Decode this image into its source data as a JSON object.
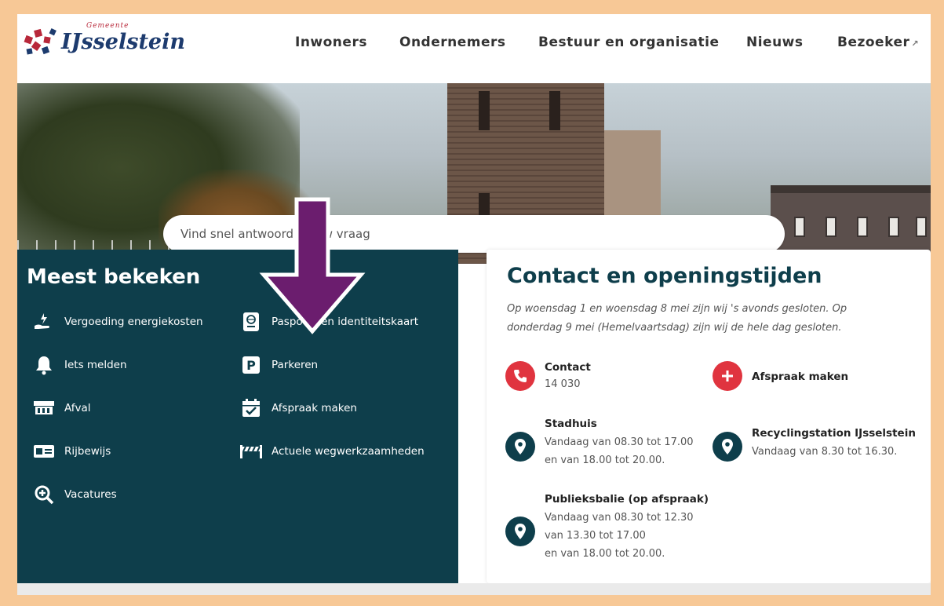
{
  "logo": {
    "small_text": "Gemeente",
    "name": "IJsselstein",
    "colors": {
      "red": "#b8283a",
      "navy": "#1d3b6e"
    }
  },
  "nav": {
    "items": [
      {
        "label": "Inwoners"
      },
      {
        "label": "Ondernemers"
      },
      {
        "label": "Bestuur en organisatie"
      },
      {
        "label": "Nieuws"
      },
      {
        "label": "Bezoeker",
        "icon": "external-link-icon"
      }
    ]
  },
  "search": {
    "placeholder": "Vind snel antwoord op uw vraag"
  },
  "meest_bekeken": {
    "title": "Meest bekeken",
    "left_items": [
      {
        "label": "Vergoeding energiekosten",
        "icon": "energy-hand-icon"
      },
      {
        "label": "Iets melden",
        "icon": "bell-icon"
      },
      {
        "label": "Afval",
        "icon": "waste-container-icon"
      },
      {
        "label": "Rijbewijs",
        "icon": "drivers-license-icon"
      },
      {
        "label": "Vacatures",
        "icon": "search-plus-icon"
      }
    ],
    "right_items": [
      {
        "label": "Paspoort en identiteitskaart",
        "icon": "passport-icon"
      },
      {
        "label": "Parkeren",
        "icon": "parking-icon"
      },
      {
        "label": "Afspraak maken",
        "icon": "calendar-check-icon"
      },
      {
        "label": "Actuele wegwerkzaamheden",
        "icon": "roadworks-icon"
      }
    ]
  },
  "contact": {
    "title": "Contact en openingstijden",
    "note": "Op woensdag 1 en woensdag 8 mei zijn wij 's avonds gesloten. Op donderdag 9 mei (Hemelvaartsdag) zijn wij de hele dag gesloten.",
    "contact_item": {
      "label": "Contact",
      "value": "14 030",
      "icon": "phone-icon"
    },
    "afspraak_item": {
      "label": "Afspraak maken",
      "icon": "plus-icon"
    },
    "stadhuis": {
      "label": "Stadhuis",
      "line1": "Vandaag van 08.30 tot 17.00",
      "line2": "en van 18.00 tot 20.00.",
      "icon": "location-pin-icon"
    },
    "recycling": {
      "label": "Recyclingstation IJsselstein",
      "line1": "Vandaag van 8.30 tot 16.30.",
      "icon": "location-pin-icon"
    },
    "publieksbalie": {
      "label": "Publieksbalie (op afspraak)",
      "line1": "Vandaag van 08.30 tot 12.30",
      "line2": "van 13.30 tot 17.00",
      "line3": "en van 18.00 tot 20.00.",
      "icon": "location-pin-icon"
    }
  },
  "colors": {
    "panel_dark": "#0e3e4b",
    "accent_red": "#e0343f",
    "arrow_purple": "#6b1d6e",
    "page_border": "#f7c896"
  }
}
